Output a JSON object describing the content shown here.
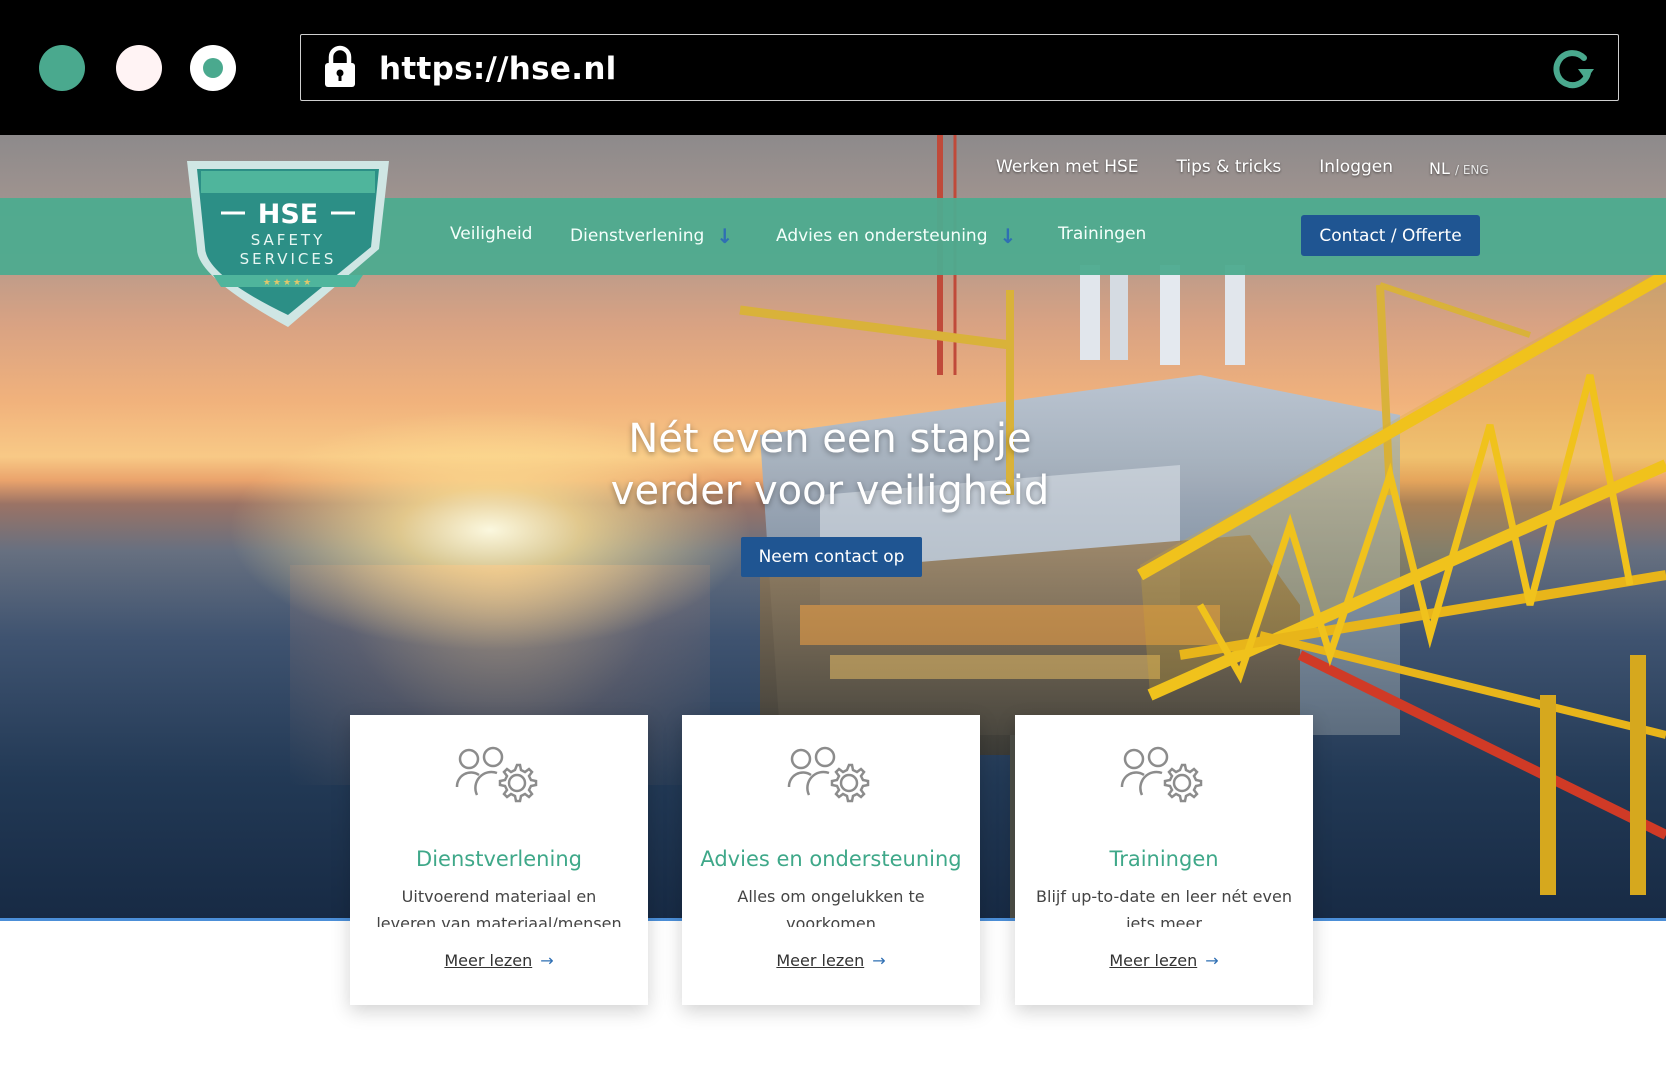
{
  "browser": {
    "url": "https://hse.nl",
    "dot_colors": [
      "#4aa98e",
      "#fff3f4",
      "#4aa98e"
    ],
    "lock_icon": "lock-icon",
    "reload_icon": "reload-icon"
  },
  "site": {
    "logo": {
      "name": "HSE",
      "line1": "SAFETY",
      "line2": "SERVICES",
      "stars": "★★★★★"
    },
    "top_nav": [
      {
        "label": "Werken met HSE"
      },
      {
        "label": "Tips & tricks"
      },
      {
        "label": "Inloggen"
      }
    ],
    "lang": {
      "nl": "NL",
      "eng": "/ ENG"
    },
    "main_nav": [
      {
        "label": "Veiligheid"
      },
      {
        "label": "Dienstverlening",
        "arrow": "↓"
      },
      {
        "label": "Advies en ondersteuning",
        "arrow": "↓"
      },
      {
        "label": "Trainingen"
      }
    ],
    "contact_button": "Contact / Offerte",
    "hero": {
      "headline_line1": "Nét even een stapje",
      "headline_line2": "verder voor veiligheid",
      "button": "Neem contact op"
    },
    "cards": [
      {
        "icon": "users-gear-icon",
        "title": "Dienstverlening",
        "text": "Uitvoerend materiaal en leveren van materiaal/mensen",
        "more": "Meer lezen",
        "arrow": "→"
      },
      {
        "icon": "users-gear-icon",
        "title": "Advies en ondersteuning",
        "text": "Alles om ongelukken te voorkomen",
        "more": "Meer lezen",
        "arrow": "→"
      },
      {
        "icon": "users-gear-icon",
        "title": "Trainingen",
        "text": "Blijf up-to-date en leer nét even iets meer",
        "more": "Meer lezen",
        "arrow": "→"
      }
    ],
    "colors": {
      "brand_green": "#4dab8f",
      "brand_blue": "#1f5592",
      "card_title": "#3fa889",
      "divider_blue": "#4c8fd8"
    }
  }
}
